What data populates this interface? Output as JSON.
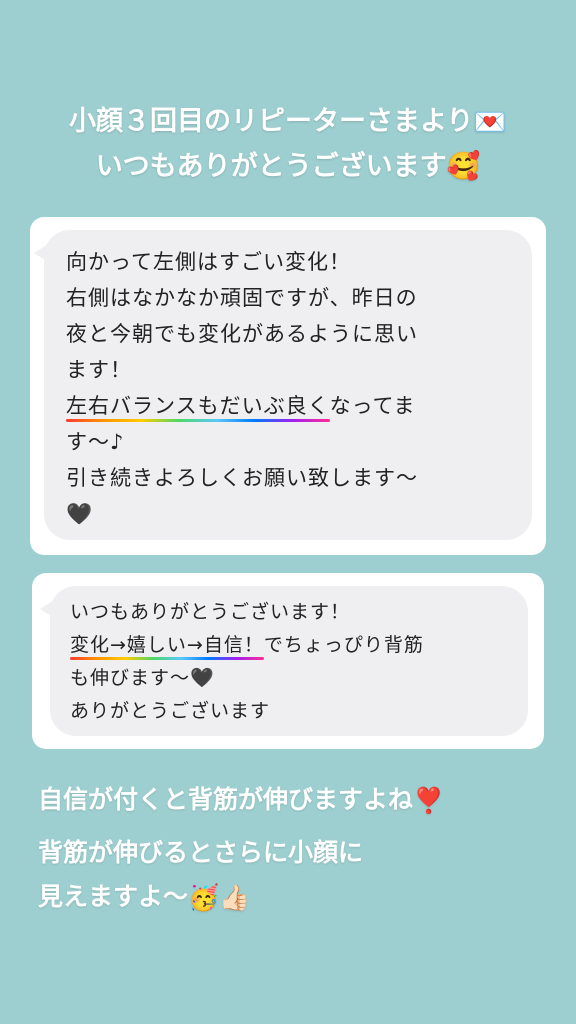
{
  "heading": {
    "line1": "小顔３回目のリピーターさまより",
    "line1_emoji": "💌",
    "line2": "いつもありがとうございます",
    "line2_emoji": "🥰"
  },
  "message1": {
    "line1": "向かって左側はすごい変化！",
    "line2": "右側はなかなか頑固ですが、昨日の",
    "line3": "夜と今朝でも変化があるように思い",
    "line4": "ます！",
    "line5_underlined": "左右バランスもだいぶ良く",
    "line5_rest": "なってま",
    "line6": "す〜♪",
    "line7": "引き続きよろしくお願い致します〜",
    "line8": "🖤"
  },
  "message2": {
    "line1": "いつもありがとうございます！",
    "line2_underlined": "変化→嬉しい→自信！",
    "line2_rest": "でちょっぴり背筋",
    "line3": "も伸びます〜🖤",
    "line4": "ありがとうございます"
  },
  "footer": {
    "line1": "自信が付くと背筋が伸びますよね",
    "line1_emoji": "❣️",
    "line2": "背筋が伸びるとさらに小顔に",
    "line3": "見えますよ〜",
    "line3_emoji": "🥳👍🏻"
  },
  "colors": {
    "background": "#9ecfd0",
    "card": "#ffffff",
    "bubble": "#efeff1"
  }
}
